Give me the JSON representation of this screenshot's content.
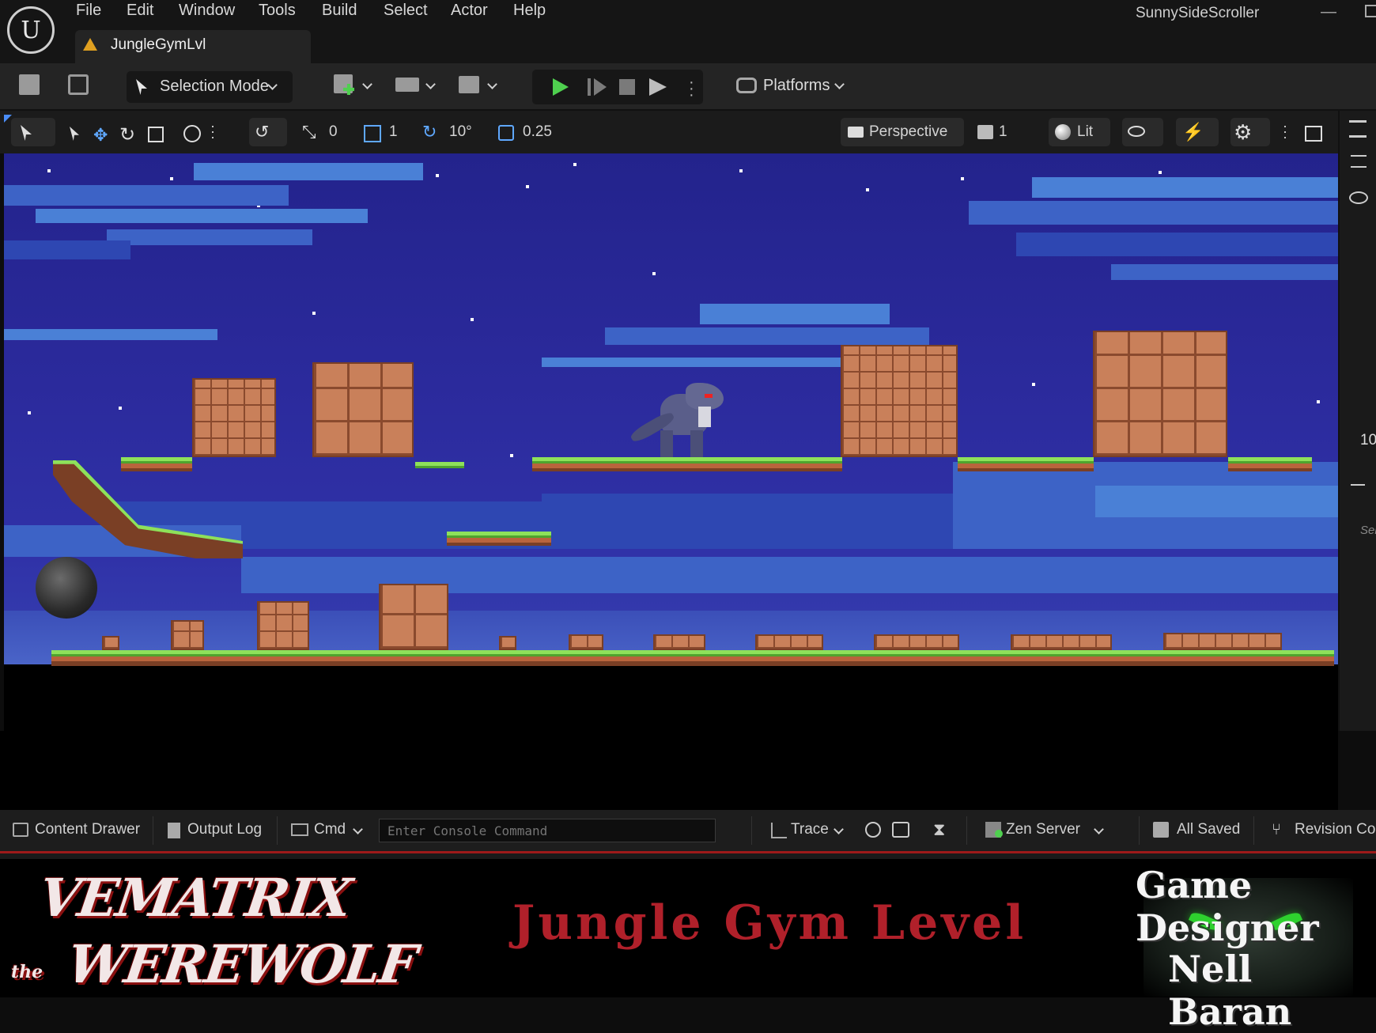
{
  "window": {
    "tab_title": "JungleGymLvl",
    "project_name": "SunnySideScroller"
  },
  "menu": [
    "File",
    "Edit",
    "Window",
    "Tools",
    "Build",
    "Select",
    "Actor",
    "Help"
  ],
  "toolbar": {
    "mode_label": "Selection Mode",
    "platforms_label": "Platforms"
  },
  "viewport_toolbar": {
    "translate_snap": "0",
    "grid_snap": "1",
    "rotate_snap": "10°",
    "scale_snap": "0.25",
    "view_mode": "Perspective",
    "camera_speed": "1",
    "lighting": "Lit"
  },
  "right_panel": {
    "value": "10",
    "hint": "Sel"
  },
  "statusbar": {
    "content_drawer": "Content Drawer",
    "output_log": "Output Log",
    "cmd": "Cmd",
    "console_placeholder": "Enter Console Command",
    "trace": "Trace",
    "zen_server": "Zen Server",
    "save_status": "All Saved",
    "revision_control": "Revision Co"
  },
  "banner": {
    "game_title_line1": "VEMATRIX",
    "game_title_the": "the",
    "game_title_line2": "WEREWOLF",
    "level_title": "Jungle Gym Level",
    "designer_role": "Game Designer",
    "designer_name": "Nell Baran"
  },
  "colors": {
    "accent_red": "#b0202a",
    "play_green": "#4fd04f",
    "sky": "#2b2a9c"
  }
}
